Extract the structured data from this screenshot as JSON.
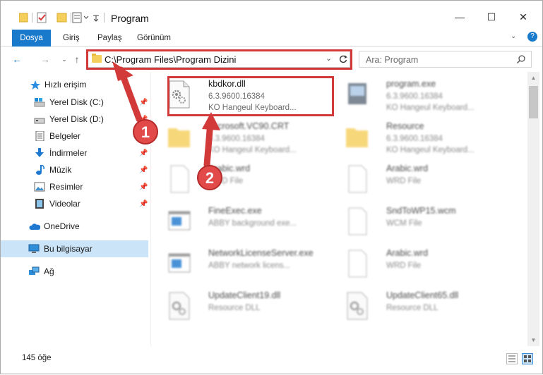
{
  "window": {
    "title": "Program",
    "controls": {
      "minimize": "—",
      "maximize": "☐",
      "close": "✕"
    }
  },
  "ribbon": {
    "tabs": [
      "Dosya",
      "Giriş",
      "Paylaş",
      "Görünüm"
    ]
  },
  "nav": {
    "address": "C:\\Program Files\\Program Dizini",
    "search_placeholder": "Ara: Program"
  },
  "sidebar": {
    "items": [
      {
        "label": "Hızlı erişim",
        "icon": "star-icon",
        "pinned": false
      },
      {
        "label": "Yerel Disk (C:)",
        "icon": "drive-icon",
        "pinned": true
      },
      {
        "label": "Yerel Disk (D:)",
        "icon": "drive-icon",
        "pinned": true
      },
      {
        "label": "Belgeler",
        "icon": "document-icon",
        "pinned": true
      },
      {
        "label": "İndirmeler",
        "icon": "download-icon",
        "pinned": true
      },
      {
        "label": "Müzik",
        "icon": "music-icon",
        "pinned": true
      },
      {
        "label": "Resimler",
        "icon": "pictures-icon",
        "pinned": true
      },
      {
        "label": "Videolar",
        "icon": "video-icon",
        "pinned": true
      },
      {
        "label": "OneDrive",
        "icon": "cloud-icon",
        "pinned": false
      },
      {
        "label": "Bu bilgisayar",
        "icon": "computer-icon",
        "pinned": false,
        "selected": true
      },
      {
        "label": "Ağ",
        "icon": "network-icon",
        "pinned": false
      }
    ]
  },
  "files": [
    {
      "name": "kbdkor.dll",
      "line1": "6.3.9600.16384",
      "line2": "KO Hangeul Keyboard...",
      "icon": "dll-gear-icon",
      "highlight": true
    },
    {
      "name": "program.exe",
      "line1": "6.3.9600.16384",
      "line2": "KO Hangeul Keyboard...",
      "icon": "exe-icon"
    },
    {
      "name": "Microsoft.VC90.CRT",
      "line1": "6.3.9600.16384",
      "line2": "KO Hangeul Keyboard...",
      "icon": "folder-icon"
    },
    {
      "name": "Resource",
      "line1": "6.3.9600.16384",
      "line2": "KO Hangeul Keyboard...",
      "icon": "folder-icon"
    },
    {
      "name": "Arabic.wrd",
      "line1": "WRD File",
      "line2": "",
      "icon": "blank-file-icon"
    },
    {
      "name": "Arabic.wrd",
      "line1": "WRD File",
      "line2": "",
      "icon": "blank-file-icon"
    },
    {
      "name": "FineExec.exe",
      "line1": "ABBY background exe...",
      "line2": "",
      "icon": "app-window-icon"
    },
    {
      "name": "SndToWP15.wcm",
      "line1": "WCM File",
      "line2": "",
      "icon": "blank-file-icon"
    },
    {
      "name": "NetworkLicenseServer.exe",
      "line1": "ABBY network licens...",
      "line2": "",
      "icon": "app-window-icon"
    },
    {
      "name": "Arabic.wrd",
      "line1": "WRD File",
      "line2": "",
      "icon": "blank-file-icon"
    },
    {
      "name": "UpdateClient19.dll",
      "line1": "Resource DLL",
      "line2": "",
      "icon": "dll-gear-icon"
    },
    {
      "name": "UpdateClient65.dll",
      "line1": "Resource DLL",
      "line2": "",
      "icon": "dll-gear-icon"
    }
  ],
  "status": {
    "count": "145 öğe"
  },
  "annotations": {
    "marker1": "1",
    "marker2": "2",
    "color": "#d23a3a"
  },
  "colors": {
    "accent": "#1979ca",
    "selection": "#cce4f7",
    "highlight_box": "#d23a3a"
  }
}
